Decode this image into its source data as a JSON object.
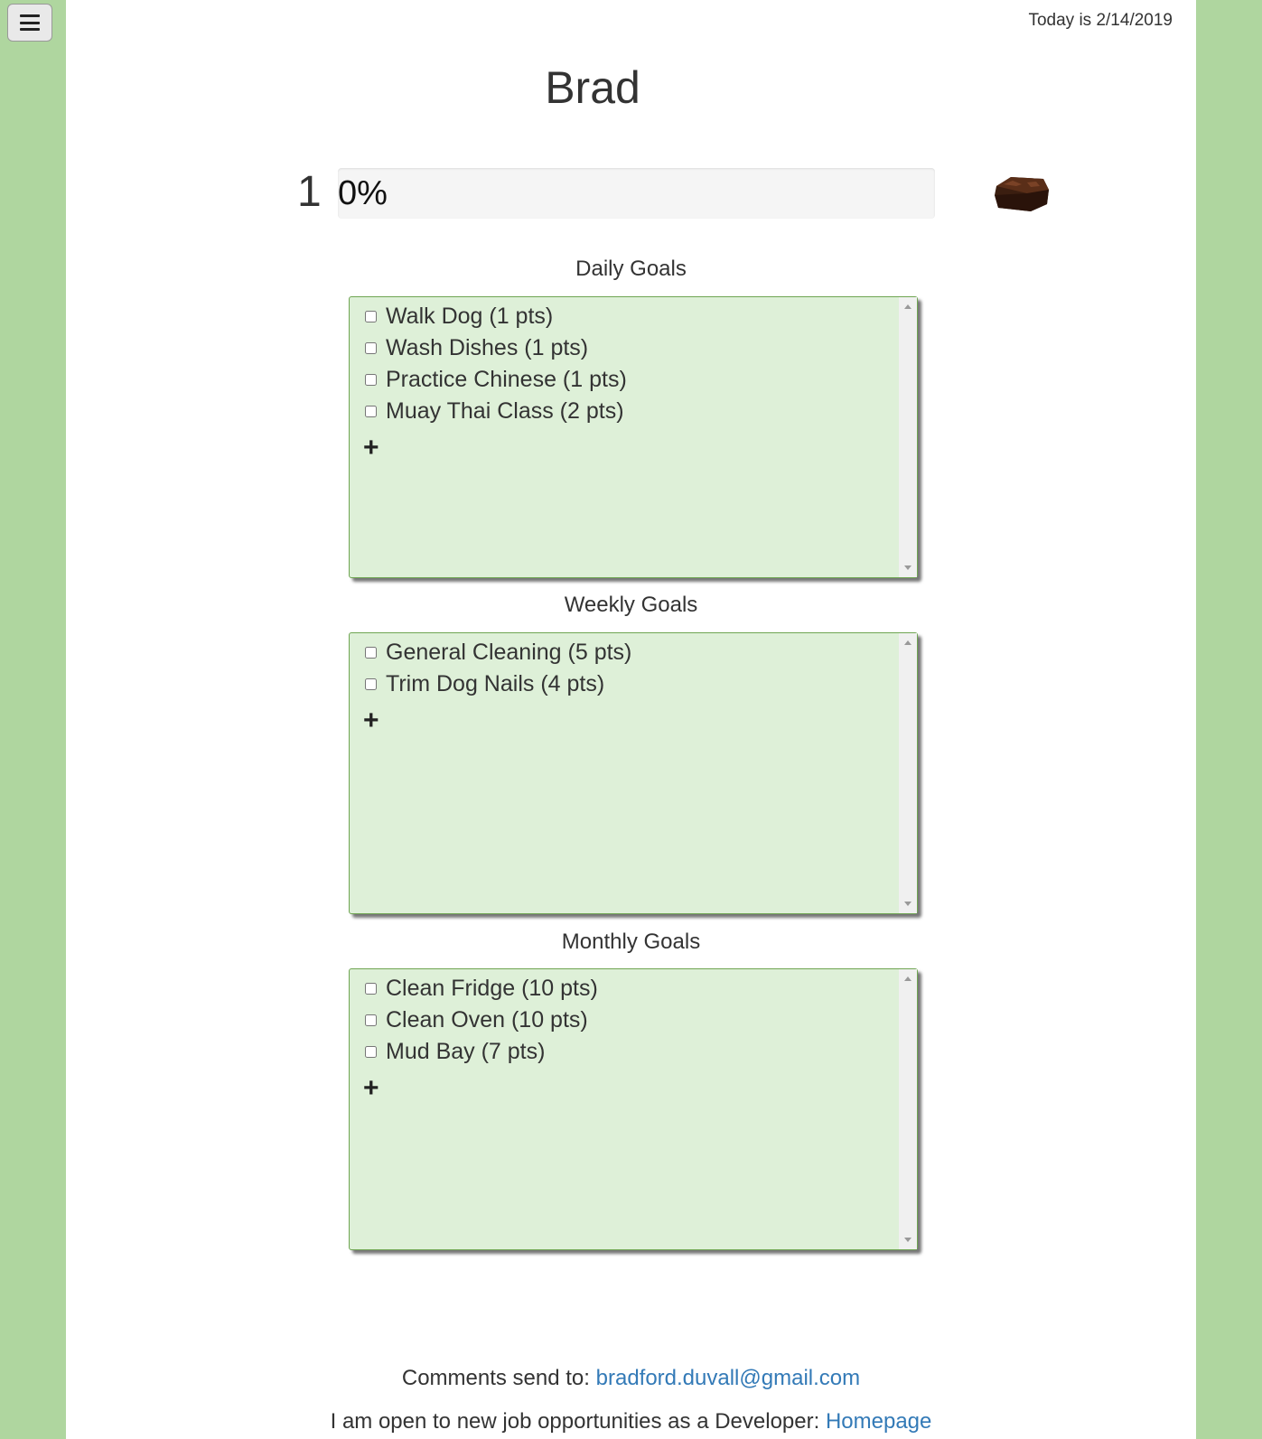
{
  "header": {
    "menu_icon": "hamburger-menu-icon",
    "date_text": "Today is 2/14/2019"
  },
  "user": {
    "name": "Brad"
  },
  "progress": {
    "level": "1",
    "percent_label": "0%",
    "percent_value": 0,
    "reward_icon": "brownie-icon"
  },
  "sections": {
    "daily": {
      "title": "Daily Goals",
      "items": [
        "Walk Dog (1 pts)",
        "Wash Dishes (1 pts)",
        "Practice Chinese (1 pts)",
        "Muay Thai Class (2 pts)"
      ],
      "add_label": "+"
    },
    "weekly": {
      "title": "Weekly Goals",
      "items": [
        "General Cleaning (5 pts)",
        "Trim Dog Nails (4 pts)"
      ],
      "add_label": "+"
    },
    "monthly": {
      "title": "Monthly Goals",
      "items": [
        "Clean Fridge (10 pts)",
        "Clean Oven (10 pts)",
        "Mud Bay (7 pts)"
      ],
      "add_label": "+"
    }
  },
  "footer": {
    "comments_prefix": "Comments send to: ",
    "comments_email": "bradford.duvall@gmail.com",
    "jobs_prefix": "I am open to new job opportunities as a Developer: ",
    "jobs_link": "Homepage"
  },
  "colors": {
    "side_background": "#afd69f",
    "goal_box_background": "#def0d8",
    "link": "#337ab7"
  }
}
